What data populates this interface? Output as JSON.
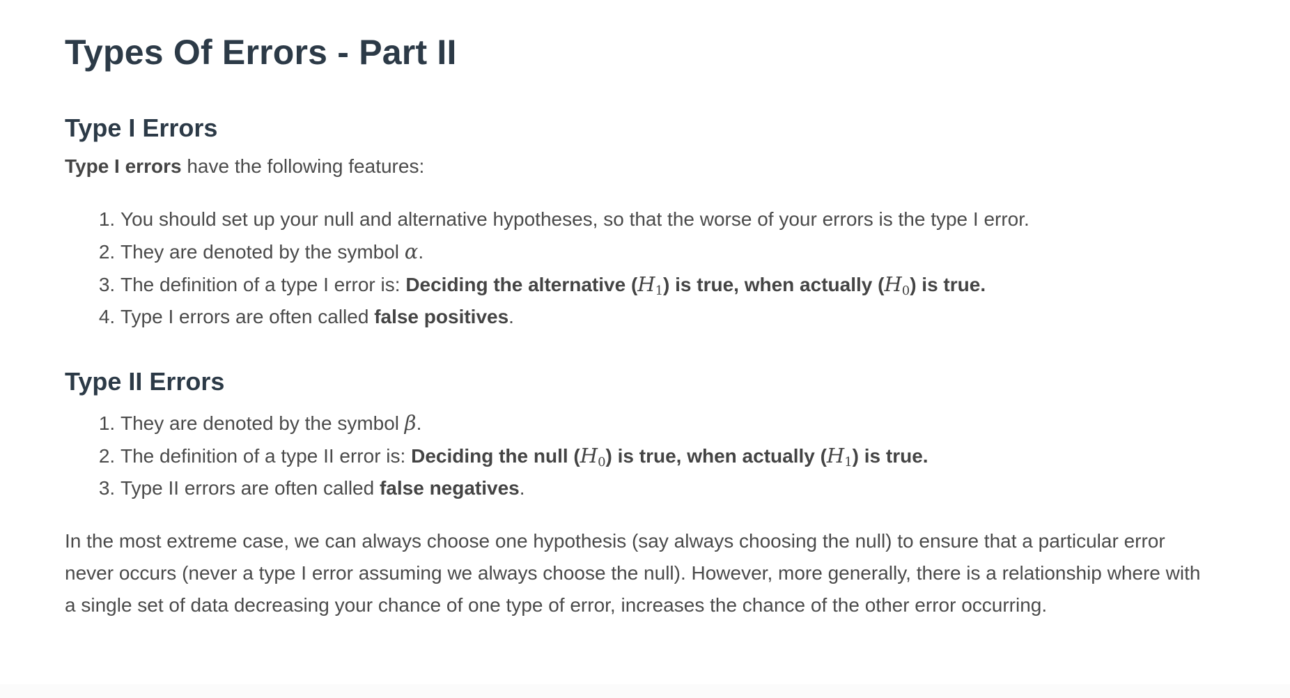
{
  "title": "Types Of Errors - Part II",
  "type1": {
    "heading": "Type I Errors",
    "intro_bold": "Type I errors",
    "intro_rest": " have the following features:",
    "items": [
      {
        "text": "You should set up your null and alternative hypotheses, so that the worse of your errors is the type I error."
      },
      {
        "pre": "They are denoted by the symbol ",
        "symbol": "α",
        "post": "."
      },
      {
        "pre": "The definition of a type I error is: ",
        "bold_a": "Deciding the alternative (",
        "sym1": "H",
        "sub1": "1",
        "bold_b": ") is true, when actually (",
        "sym2": "H",
        "sub2": "0",
        "bold_c": ") is true."
      },
      {
        "pre": "Type I errors are often called ",
        "bold": "false positives",
        "post": "."
      }
    ]
  },
  "type2": {
    "heading": "Type II Errors",
    "items": [
      {
        "pre": "They are denoted by the symbol ",
        "symbol": "β",
        "post": "."
      },
      {
        "pre": "The definition of a type II error is: ",
        "bold_a": "Deciding the null (",
        "sym1": "H",
        "sub1": "0",
        "bold_b": ") is true, when actually (",
        "sym2": "H",
        "sub2": "1",
        "bold_c": ") is true."
      },
      {
        "pre": "Type II errors are often called ",
        "bold": "false negatives",
        "post": "."
      }
    ]
  },
  "closing": "In the most extreme case, we can always choose one hypothesis (say always choosing the null) to ensure that a particular error never occurs (never a type I error assuming we always choose the null). However, more generally, there is a relationship where with a single set of data decreasing your chance of one type of error, increases the chance of the other error occurring."
}
